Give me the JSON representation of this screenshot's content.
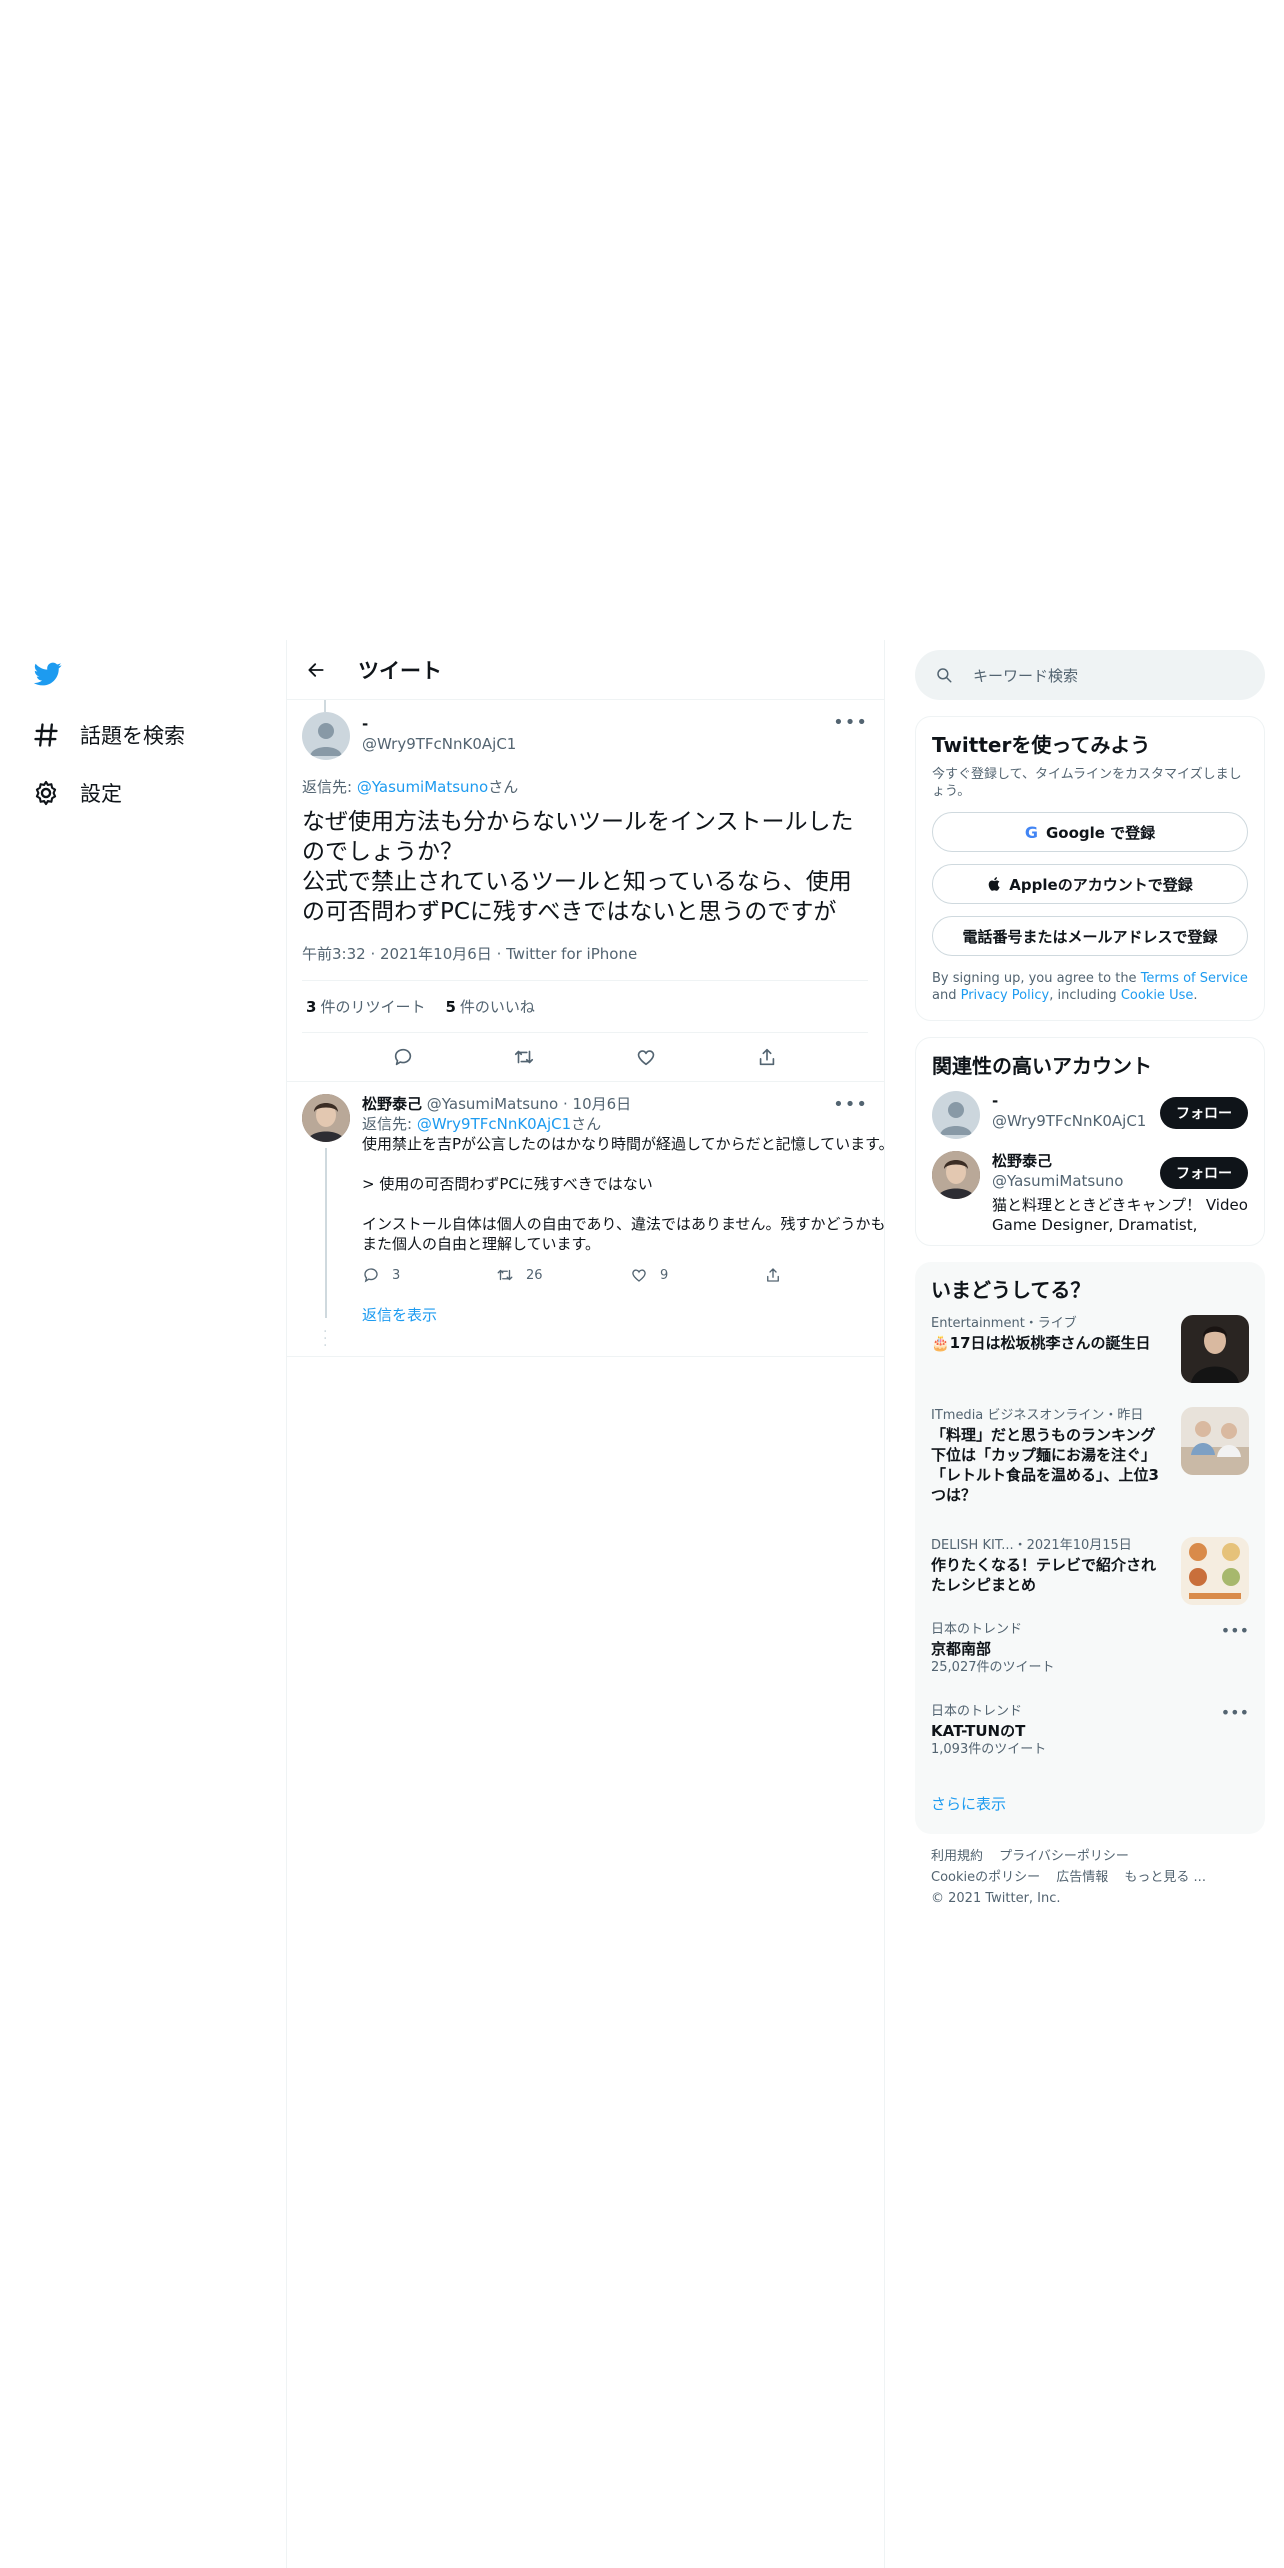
{
  "nav": {
    "explore_label": "話題を検索",
    "settings_label": "設定"
  },
  "header": {
    "title": "ツイート"
  },
  "tweet": {
    "author_name": "-",
    "author_handle": "@Wry9TFcNnK0AjC1",
    "reply_prefix": "返信先: ",
    "reply_to_handle": "@YasumiMatsuno",
    "reply_suffix": "さん",
    "text": "なぜ使用方法も分からないツールをインストールしたのでしょうか？\n公式で禁止されているツールと知っているなら、使用の可否問わずPCに残すべきではないと思うのですが",
    "time": "午前3:32",
    "date": "2021年10月6日",
    "source": "Twitter for iPhone",
    "retweets": "3",
    "retweets_label": "件のリツイート",
    "likes": "5",
    "likes_label": "件のいいね"
  },
  "reply": {
    "author_name": "松野泰己",
    "author_handle": "@YasumiMatsuno",
    "date": "10月6日",
    "reply_prefix": "返信先: ",
    "reply_to_handle": "@Wry9TFcNnK0AjC1",
    "reply_suffix": "さん",
    "text": "使用禁止を吉Pが公言したのはかなり時間が経過してからだと記憶しています。\n\n> 使用の可否問わずPCに残すべきではない\n\nインストール自体は個人の自由であり、違法ではありません。残すかどうかもまた個人の自由と理解しています。",
    "reply_count": "3",
    "retweet_count": "26",
    "like_count": "9",
    "show_replies": "返信を表示"
  },
  "sidebar": {
    "search_placeholder": "キーワード検索",
    "signup": {
      "title": "Twitterを使ってみよう",
      "desc": "今すぐ登録して、タイムラインをカスタマイズしましょう。",
      "google_label": "Google で登録",
      "apple_label": "Appleのアカウントで登録",
      "phone_label": "電話番号またはメールアドレスで登録",
      "legal_1": "By signing up, you agree to the ",
      "tos": "Terms of Service",
      "legal_2": " and ",
      "privacy": "Privacy Policy",
      "legal_3": ", including ",
      "cookie": "Cookie Use",
      "legal_4": "."
    },
    "related": {
      "title": "関連性の高いアカウント",
      "follow_label": "フォロー",
      "accounts": [
        {
          "name": "-",
          "handle": "@Wry9TFcNnK0AjC1",
          "bio": ""
        },
        {
          "name": "松野泰己",
          "handle": "@YasumiMatsuno",
          "bio": "猫と料理とときどきキャンプ！ Video Game Designer, Dramatist, Writer,"
        }
      ]
    },
    "trends": {
      "title": "いまどうしてる？",
      "items": [
        {
          "meta": "Entertainment・ライブ",
          "title": "🎂17日は松坂桃李さんの誕生日",
          "count": ""
        },
        {
          "meta": "ITmedia ビジネスオンライン・昨日",
          "title": "「料理」だと思うものランキング　下位は「カップ麺にお湯を注ぐ」「レトルト食品を温める」、上位3つは？",
          "count": ""
        },
        {
          "meta": "DELISH KIT...・2021年10月15日",
          "title": "作りたくなる！テレビで紹介されたレシピまとめ",
          "count": ""
        },
        {
          "meta": "日本のトレンド",
          "title": "京都南部",
          "count": "25,027件のツイート"
        },
        {
          "meta": "日本のトレンド",
          "title": "KAT-TUNのT",
          "count": "1,093件のツイート"
        }
      ],
      "show_more": "さらに表示"
    },
    "footer": {
      "terms": "利用規約",
      "privacy": "プライバシーポリシー",
      "cookie": "Cookieのポリシー",
      "ads": "広告情報",
      "more": "もっと見る ...",
      "copyright": "© 2021 Twitter, Inc."
    }
  },
  "colors": {
    "accent": "#1d9bf0",
    "text": "#0f1419",
    "muted": "#536471",
    "border": "#eff3f4"
  }
}
